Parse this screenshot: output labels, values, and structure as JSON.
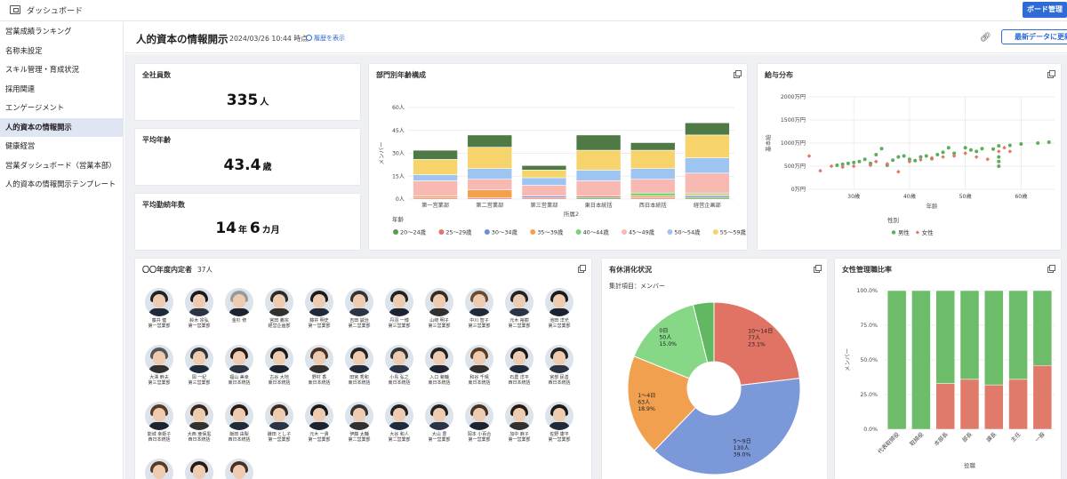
{
  "topbar": {
    "title": "ダッシュボード",
    "manage_button": "ボード管理"
  },
  "sidebar": {
    "items": [
      {
        "label": "営業成績ランキング",
        "active": false
      },
      {
        "label": "名称未設定",
        "active": false
      },
      {
        "label": "スキル管理・育成状況",
        "active": false
      },
      {
        "label": "採用関連",
        "active": false
      },
      {
        "label": "エンゲージメント",
        "active": false
      },
      {
        "label": "人的資本の情報開示",
        "active": true
      },
      {
        "label": "健康経営",
        "active": false
      },
      {
        "label": "営業ダッシュボード（営業本部）",
        "active": false
      },
      {
        "label": "人的資本の情報開示テンプレート",
        "active": false
      }
    ]
  },
  "header": {
    "title": "人的資本の情報開示",
    "timestamp": "2024/03/26 10:44 時点",
    "history_link": "履歴を表示",
    "refresh_button": "最新データに更新"
  },
  "kpis": {
    "total": {
      "title": "全社員数",
      "value": "335",
      "unit": "人"
    },
    "age": {
      "title": "平均年齢",
      "value": "43.4",
      "unit": "歳"
    },
    "tenure": {
      "title": "平均勤続年数",
      "value_years": "14",
      "unit_years": "年",
      "value_months": "6",
      "unit_months": "カ月"
    }
  },
  "cards": {
    "dept_age": "部門別年齢構成",
    "salary": "給与分布",
    "employees": "〇〇年度内定者",
    "employees_count": "37人",
    "leave": "有休消化状況",
    "female_mgr": "女性管理職比率"
  },
  "employees": [
    {
      "name": "藤井 健",
      "dept": "第一営業部",
      "hair": "#222"
    },
    {
      "name": "鈴木 宗弘",
      "dept": "第一営業部",
      "hair": "#1a1a1a"
    },
    {
      "name": "金杉 修",
      "dept": "",
      "hair": "#999"
    },
    {
      "name": "宮田 義宗",
      "dept": "経営企画部",
      "hair": "#2a2a2a"
    },
    {
      "name": "藤井 明史",
      "dept": "第一営業部",
      "hair": "#1a1a1a"
    },
    {
      "name": "吉田 誠治",
      "dept": "第二営業部",
      "hair": "#333"
    },
    {
      "name": "丹羽 一博",
      "dept": "第三営業部",
      "hair": "#222"
    },
    {
      "name": "山﨑 明子",
      "dept": "第三営業部",
      "hair": "#3a2a1e"
    },
    {
      "name": "中川 智子",
      "dept": "第三営業部",
      "hair": "#6a4a32"
    },
    {
      "name": "元木 裕樹",
      "dept": "第二営業部",
      "hair": "#222"
    },
    {
      "name": "池田 洋光",
      "dept": "第三営業部",
      "hair": "#1a1a1a"
    },
    {
      "name": "大澤 幹夫",
      "dept": "第三営業部",
      "hair": "#555"
    },
    {
      "name": "岡 一紀",
      "dept": "第三営業部",
      "hair": "#333"
    },
    {
      "name": "福山 美幸",
      "dept": "東日本統括",
      "hair": "#2a1a10"
    },
    {
      "name": "古谷 大地",
      "dept": "東日本統括",
      "hair": "#1a1a1a"
    },
    {
      "name": "野村 香",
      "dept": "東日本統括",
      "hair": "#4a3020"
    },
    {
      "name": "田宮 秀和",
      "dept": "東日本統括",
      "hair": "#222"
    },
    {
      "name": "小島 弘之",
      "dept": "東日本統括",
      "hair": "#333"
    },
    {
      "name": "入口 菊輔",
      "dept": "東日本統括",
      "hair": "#222"
    },
    {
      "name": "和谷 千晴",
      "dept": "東日本統括",
      "hair": "#5a3a22"
    },
    {
      "name": "石農 洋平",
      "dept": "西日本統括",
      "hair": "#1a1a1a"
    },
    {
      "name": "宮部 民善",
      "dept": "西日本統括",
      "hair": "#222"
    },
    {
      "name": "能城 幸姫子",
      "dept": "西日本統括",
      "hair": "#5a3a22"
    },
    {
      "name": "大西 亜保黒",
      "dept": "西日本統括",
      "hair": "#3a2516"
    },
    {
      "name": "飯田 由梨",
      "dept": "西日本統括",
      "hair": "#2a1a10"
    },
    {
      "name": "鎌田 とし子",
      "dept": "第一営業部",
      "hair": "#3a2a1e"
    },
    {
      "name": "元木 一貴",
      "dept": "第一営業部",
      "hair": "#1a1a1a"
    },
    {
      "name": "伊藤 太輔",
      "dept": "第二営業部",
      "hair": "#333"
    },
    {
      "name": "大谷 和人",
      "dept": "第二営業部",
      "hair": "#222"
    },
    {
      "name": "大山 豊",
      "dept": "第一営業部",
      "hair": "#222"
    },
    {
      "name": "岡本 小百合",
      "dept": "第一営業部",
      "hair": "#4a3020"
    },
    {
      "name": "加中 麻子",
      "dept": "第一営業部",
      "hair": "#2a1a10"
    },
    {
      "name": "佐野 康平",
      "dept": "第一営業部",
      "hair": "#1a1a1a"
    },
    {
      "name": "",
      "dept": "",
      "hair": "#5a3a22"
    },
    {
      "name": "",
      "dept": "",
      "hair": "#2a1a10"
    },
    {
      "name": "",
      "dept": "",
      "hair": "#4a3020"
    }
  ],
  "chart_data": [
    {
      "type": "bar",
      "stacked": true,
      "title": "部門別年齢構成",
      "xlabel": "所属2",
      "ylabel": "メンバー",
      "ylim": [
        0,
        60
      ],
      "yticks": [
        "0人",
        "15人",
        "30人",
        "45人",
        "60人"
      ],
      "categories": [
        "第一営業部",
        "第二営業部",
        "第三営業部",
        "東日本統括",
        "西日本統括",
        "経営企画部"
      ],
      "legend_title": "年齢",
      "series": [
        {
          "name": "20〜24歳",
          "color": "#5a9a53",
          "values": [
            0,
            0,
            0,
            1,
            0,
            1
          ]
        },
        {
          "name": "25〜29歳",
          "color": "#e07869",
          "values": [
            1,
            1,
            1,
            1,
            1,
            0
          ]
        },
        {
          "name": "30〜34歳",
          "color": "#6f8ed6",
          "values": [
            0,
            0,
            1,
            0,
            0,
            1
          ]
        },
        {
          "name": "35〜39歳",
          "color": "#f3a14a",
          "values": [
            1,
            5,
            0,
            0,
            1,
            1
          ]
        },
        {
          "name": "40〜44歳",
          "color": "#7fd07a",
          "values": [
            0,
            0,
            0,
            0,
            2,
            1
          ]
        },
        {
          "name": "45〜49歳",
          "color": "#f7b9b2",
          "values": [
            10,
            7,
            7,
            10,
            9,
            13
          ]
        },
        {
          "name": "50〜54歳",
          "color": "#9ec4f2",
          "values": [
            4,
            7,
            5,
            7,
            7,
            10
          ]
        },
        {
          "name": "55〜59歳",
          "color": "#f6d36b",
          "values": [
            10,
            14,
            5,
            13,
            12,
            15
          ]
        },
        {
          "name": "60〜65歳",
          "color": "#4f7a45",
          "values": [
            6,
            8,
            3,
            10,
            5,
            8
          ]
        }
      ]
    },
    {
      "type": "scatter",
      "title": "給与分布",
      "xlabel": "年齢",
      "ylabel": "基本給",
      "xlim": [
        22,
        66
      ],
      "xticks": [
        "30歳",
        "40歳",
        "50歳",
        "60歳"
      ],
      "ylim": [
        0,
        2000
      ],
      "yticks": [
        "0万円",
        "500万円",
        "1000万円",
        "1500万円",
        "2000万円"
      ],
      "legend_title": "性別",
      "series": [
        {
          "name": "男性",
          "color": "#5cae5c",
          "points": [
            [
              27,
              520
            ],
            [
              28,
              540
            ],
            [
              29,
              560
            ],
            [
              30,
              580
            ],
            [
              31,
              600
            ],
            [
              32,
              650
            ],
            [
              33,
              560
            ],
            [
              34,
              750
            ],
            [
              35,
              880
            ],
            [
              36,
              520
            ],
            [
              37,
              630
            ],
            [
              38,
              700
            ],
            [
              39,
              720
            ],
            [
              40,
              650
            ],
            [
              41,
              620
            ],
            [
              42,
              700
            ],
            [
              43,
              720
            ],
            [
              44,
              660
            ],
            [
              45,
              750
            ],
            [
              46,
              800
            ],
            [
              47,
              900
            ],
            [
              48,
              780
            ],
            [
              50,
              900
            ],
            [
              51,
              850
            ],
            [
              52,
              820
            ],
            [
              53,
              880
            ],
            [
              55,
              870
            ],
            [
              56,
              940
            ],
            [
              56,
              700
            ],
            [
              56,
              600
            ],
            [
              56,
              500
            ],
            [
              58,
              950
            ],
            [
              60,
              980
            ],
            [
              63,
              1000
            ],
            [
              65,
              1020
            ]
          ]
        },
        {
          "name": "女性",
          "color": "#e07867",
          "points": [
            [
              22,
              720
            ],
            [
              24,
              400
            ],
            [
              26,
              500
            ],
            [
              28,
              480
            ],
            [
              30,
              500
            ],
            [
              33,
              520
            ],
            [
              34,
              600
            ],
            [
              36,
              550
            ],
            [
              38,
              380
            ],
            [
              40,
              600
            ],
            [
              42,
              640
            ],
            [
              44,
              680
            ],
            [
              46,
              700
            ],
            [
              48,
              720
            ],
            [
              50,
              780
            ],
            [
              52,
              700
            ],
            [
              54,
              650
            ],
            [
              56,
              820
            ],
            [
              57,
              900
            ],
            [
              58,
              820
            ]
          ]
        }
      ]
    },
    {
      "type": "pie",
      "title": "有休消化状況",
      "subtitle": "集計項目：メンバー",
      "slices": [
        {
          "label": "10〜14日",
          "value": 77,
          "percent": "23.1%",
          "count_label": "77人",
          "color": "#e07364"
        },
        {
          "label": "5〜9日",
          "value": 130,
          "percent": "39.0%",
          "count_label": "130人",
          "color": "#7b99d9"
        },
        {
          "label": "1〜4日",
          "value": 63,
          "percent": "18.9%",
          "count_label": "63人",
          "color": "#f1a04f"
        },
        {
          "label": "0日",
          "value": 50,
          "percent": "15.0%",
          "count_label": "50人",
          "color": "#86d887"
        },
        {
          "label": "",
          "value": 13,
          "percent": "",
          "count_label": "",
          "color": "#62b862"
        }
      ]
    },
    {
      "type": "bar",
      "stacked": true,
      "percent": true,
      "title": "女性管理職比率",
      "xlabel": "役職",
      "ylabel": "メンバー",
      "ylim": [
        0,
        100
      ],
      "yticks": [
        "0.0%",
        "25.0%",
        "50.0%",
        "75.0%",
        "100.0%"
      ],
      "categories": [
        "代表取締役",
        "取締役",
        "本部長",
        "部長",
        "課長",
        "主任",
        "一般"
      ],
      "series": [
        {
          "name": "女性",
          "color": "#e07a6a",
          "values": [
            0,
            0,
            33,
            36,
            32,
            36,
            46
          ]
        },
        {
          "name": "男性",
          "color": "#6cbc6a",
          "values": [
            100,
            100,
            67,
            64,
            68,
            64,
            54
          ]
        }
      ]
    }
  ]
}
